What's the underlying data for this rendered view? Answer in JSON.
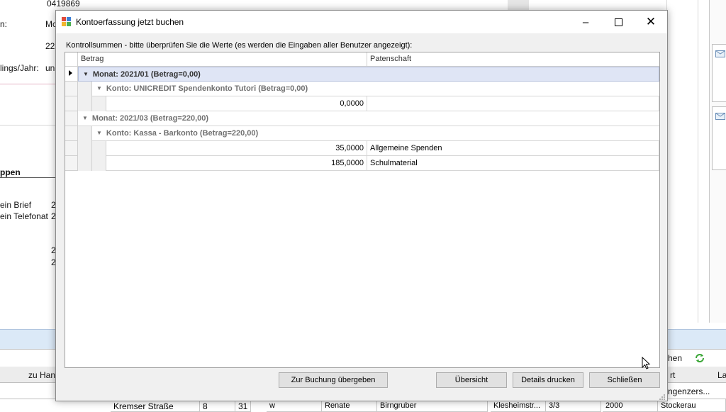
{
  "background": {
    "top_value": "0419869",
    "left_labels": [
      "n:",
      "lings/Jahr:"
    ],
    "left_values": [
      "Mc",
      "22",
      "un"
    ],
    "section_heading": "ppen",
    "list_items": [
      {
        "label": "ein Brief",
        "value": "2"
      },
      {
        "label": "ein Telefonat",
        "value": "2"
      }
    ],
    "extra_values": [
      "2",
      "2"
    ],
    "zu_han": "zu Han",
    "right_hen": "hen",
    "right_cols": [
      "rt",
      "La"
    ],
    "right_cut": "ngenzers...",
    "bottom_row": {
      "street": "Kremser Straße",
      "num1": "8",
      "num2": "31",
      "w": "w",
      "first": "Renate",
      "last": "Birngruber",
      "street2": "Klesheimstr...",
      "frac": "3/3",
      "zip": "2000",
      "city": "Stockerau"
    }
  },
  "dialog": {
    "title": "Kontoerfassung jetzt buchen",
    "subtitle": "Kontrollsummen - bitte überprüfen Sie die Werte (es werden die Eingaben aller Benutzer angezeigt):",
    "columns": {
      "betrag": "Betrag",
      "patenschaft": "Patenschaft"
    },
    "groups": [
      {
        "label": "Monat: 2021/01 (Betrag=0,00)",
        "accounts": [
          {
            "label": "Konto: UNICREDIT Spendenkonto Tutori (Betrag=0,00)",
            "rows": [
              {
                "betrag": "0,0000",
                "patenschaft": ""
              }
            ]
          }
        ]
      },
      {
        "label": "Monat: 2021/03 (Betrag=220,00)",
        "accounts": [
          {
            "label": "Konto: Kassa - Barkonto (Betrag=220,00)",
            "rows": [
              {
                "betrag": "35,0000",
                "patenschaft": "Allgemeine Spenden"
              },
              {
                "betrag": "185,0000",
                "patenschaft": "Schulmaterial"
              }
            ]
          }
        ]
      }
    ],
    "buttons": {
      "zur_buchung": "Zur Buchung übergeben",
      "uebersicht": "Übersicht",
      "details": "Details drucken",
      "schliessen": "Schließen"
    }
  },
  "icons": [
    "app-icon",
    "minimize-icon",
    "maximize-icon",
    "close-icon",
    "refresh-icon",
    "mail-icon",
    "row-pointer-icon",
    "collapse-icon"
  ]
}
